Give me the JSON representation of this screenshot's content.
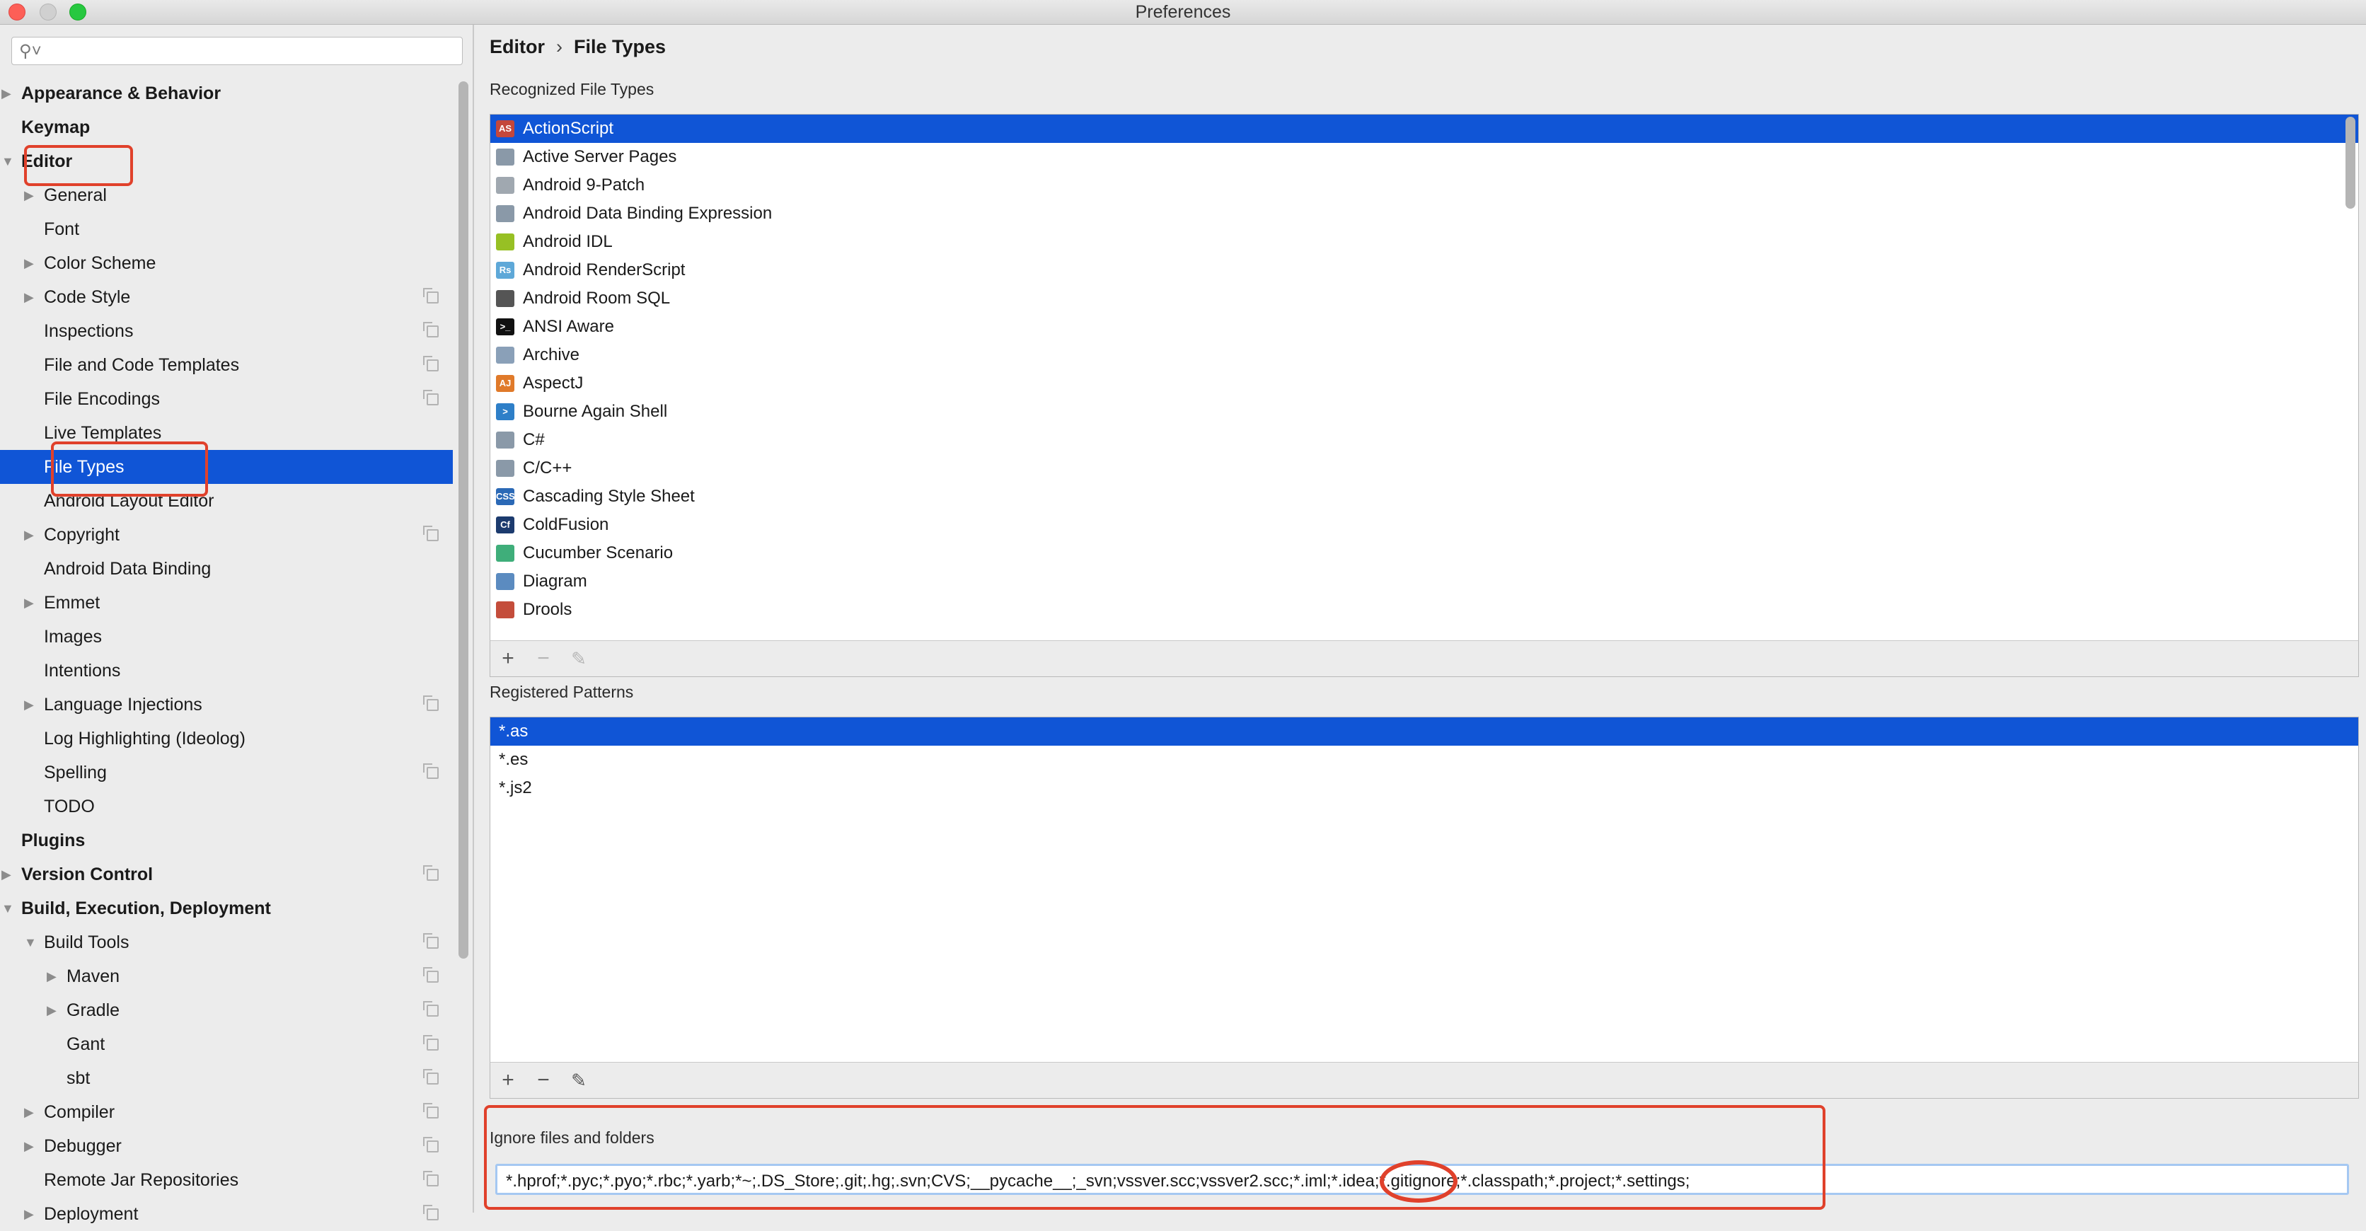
{
  "window": {
    "title": "Preferences"
  },
  "search": {
    "placeholder": "",
    "icon": "search-icon"
  },
  "sidebar": {
    "items": [
      {
        "label": "Appearance & Behavior",
        "level": 0,
        "arrow": "right",
        "bold": true,
        "copy": false
      },
      {
        "label": "Keymap",
        "level": 0,
        "arrow": "",
        "bold": true,
        "copy": false
      },
      {
        "label": "Editor",
        "level": 0,
        "arrow": "down",
        "bold": true,
        "copy": false
      },
      {
        "label": "General",
        "level": 1,
        "arrow": "right",
        "bold": false,
        "copy": false
      },
      {
        "label": "Font",
        "level": 1,
        "arrow": "",
        "bold": false,
        "copy": false
      },
      {
        "label": "Color Scheme",
        "level": 1,
        "arrow": "right",
        "bold": false,
        "copy": false
      },
      {
        "label": "Code Style",
        "level": 1,
        "arrow": "right",
        "bold": false,
        "copy": true
      },
      {
        "label": "Inspections",
        "level": 1,
        "arrow": "",
        "bold": false,
        "copy": true
      },
      {
        "label": "File and Code Templates",
        "level": 1,
        "arrow": "",
        "bold": false,
        "copy": true
      },
      {
        "label": "File Encodings",
        "level": 1,
        "arrow": "",
        "bold": false,
        "copy": true
      },
      {
        "label": "Live Templates",
        "level": 1,
        "arrow": "",
        "bold": false,
        "copy": false
      },
      {
        "label": "File Types",
        "level": 1,
        "arrow": "",
        "bold": false,
        "copy": false,
        "selected": true
      },
      {
        "label": "Android Layout Editor",
        "level": 1,
        "arrow": "",
        "bold": false,
        "copy": false
      },
      {
        "label": "Copyright",
        "level": 1,
        "arrow": "right",
        "bold": false,
        "copy": true
      },
      {
        "label": "Android Data Binding",
        "level": 1,
        "arrow": "",
        "bold": false,
        "copy": false
      },
      {
        "label": "Emmet",
        "level": 1,
        "arrow": "right",
        "bold": false,
        "copy": false
      },
      {
        "label": "Images",
        "level": 1,
        "arrow": "",
        "bold": false,
        "copy": false
      },
      {
        "label": "Intentions",
        "level": 1,
        "arrow": "",
        "bold": false,
        "copy": false
      },
      {
        "label": "Language Injections",
        "level": 1,
        "arrow": "right",
        "bold": false,
        "copy": true
      },
      {
        "label": "Log Highlighting (Ideolog)",
        "level": 1,
        "arrow": "",
        "bold": false,
        "copy": false
      },
      {
        "label": "Spelling",
        "level": 1,
        "arrow": "",
        "bold": false,
        "copy": true
      },
      {
        "label": "TODO",
        "level": 1,
        "arrow": "",
        "bold": false,
        "copy": false
      },
      {
        "label": "Plugins",
        "level": 0,
        "arrow": "",
        "bold": true,
        "copy": false
      },
      {
        "label": "Version Control",
        "level": 0,
        "arrow": "right",
        "bold": true,
        "copy": true
      },
      {
        "label": "Build, Execution, Deployment",
        "level": 0,
        "arrow": "down",
        "bold": true,
        "copy": false
      },
      {
        "label": "Build Tools",
        "level": 1,
        "arrow": "down",
        "bold": false,
        "copy": true
      },
      {
        "label": "Maven",
        "level": 2,
        "arrow": "right",
        "bold": false,
        "copy": true
      },
      {
        "label": "Gradle",
        "level": 2,
        "arrow": "right",
        "bold": false,
        "copy": true
      },
      {
        "label": "Gant",
        "level": 2,
        "arrow": "",
        "bold": false,
        "copy": true
      },
      {
        "label": "sbt",
        "level": 2,
        "arrow": "",
        "bold": false,
        "copy": true
      },
      {
        "label": "Compiler",
        "level": 1,
        "arrow": "right",
        "bold": false,
        "copy": true
      },
      {
        "label": "Debugger",
        "level": 1,
        "arrow": "right",
        "bold": false,
        "copy": true
      },
      {
        "label": "Remote Jar Repositories",
        "level": 1,
        "arrow": "",
        "bold": false,
        "copy": true
      },
      {
        "label": "Deployment",
        "level": 1,
        "arrow": "right",
        "bold": false,
        "copy": true
      }
    ]
  },
  "breadcrumb": {
    "part1": "Editor",
    "separator": "›",
    "part2": "File Types"
  },
  "recognized": {
    "title": "Recognized File Types",
    "items": [
      {
        "label": "ActionScript",
        "icon": "actionscript-icon",
        "icon_color": "#c4473b",
        "icon_text": "AS",
        "selected": true
      },
      {
        "label": "Active Server Pages",
        "icon": "asp-icon",
        "icon_color": "#8a99a8",
        "icon_text": ""
      },
      {
        "label": "Android 9-Patch",
        "icon": "folder-icon",
        "icon_color": "#a0a8b0",
        "icon_text": ""
      },
      {
        "label": "Android Data Binding Expression",
        "icon": "generic-file-icon",
        "icon_color": "#8a99a8",
        "icon_text": ""
      },
      {
        "label": "Android IDL",
        "icon": "android-icon",
        "icon_color": "#97c024",
        "icon_text": ""
      },
      {
        "label": "Android RenderScript",
        "icon": "renderscript-icon",
        "icon_color": "#5ea8d8",
        "icon_text": "Rs"
      },
      {
        "label": "Android Room SQL",
        "icon": "database-icon",
        "icon_color": "#555555",
        "icon_text": ""
      },
      {
        "label": "ANSI Aware",
        "icon": "terminal-icon",
        "icon_color": "#111111",
        "icon_text": ">_"
      },
      {
        "label": "Archive",
        "icon": "archive-icon",
        "icon_color": "#8aa0b8",
        "icon_text": ""
      },
      {
        "label": "AspectJ",
        "icon": "aspectj-icon",
        "icon_color": "#e07a2a",
        "icon_text": "AJ"
      },
      {
        "label": "Bourne Again Shell",
        "icon": "shell-icon",
        "icon_color": "#2e7fc8",
        "icon_text": ">"
      },
      {
        "label": "C#",
        "icon": "csharp-icon",
        "icon_color": "#8a99a8",
        "icon_text": ""
      },
      {
        "label": "C/C++",
        "icon": "cpp-icon",
        "icon_color": "#8a99a8",
        "icon_text": ""
      },
      {
        "label": "Cascading Style Sheet",
        "icon": "css-icon",
        "icon_color": "#2b69b6",
        "icon_text": "CSS"
      },
      {
        "label": "ColdFusion",
        "icon": "coldfusion-icon",
        "icon_color": "#1c3b6e",
        "icon_text": "Cf"
      },
      {
        "label": "Cucumber Scenario",
        "icon": "cucumber-icon",
        "icon_color": "#3fae7a",
        "icon_text": ""
      },
      {
        "label": "Diagram",
        "icon": "diagram-icon",
        "icon_color": "#5b8bc0",
        "icon_text": ""
      },
      {
        "label": "Drools",
        "icon": "drools-icon",
        "icon_color": "#c44d3b",
        "icon_text": ""
      }
    ]
  },
  "patterns": {
    "title": "Registered Patterns",
    "items": [
      {
        "label": "*.as",
        "selected": true
      },
      {
        "label": "*.es",
        "selected": false
      },
      {
        "label": "*.js2",
        "selected": false
      }
    ]
  },
  "toolbar": {
    "add": "+",
    "remove": "−",
    "edit": "✎"
  },
  "ignore": {
    "title": "Ignore files and folders",
    "value": "*.hprof;*.pyc;*.pyo;*.rbc;*.yarb;*~;.DS_Store;.git;.hg;.svn;CVS;__pycache__;_svn;vssver.scc;vssver2.scc;*.iml;*.idea;*.gitignore;*.classpath;*.project;*.settings;"
  },
  "colors": {
    "selection": "#1055d6",
    "annotation": "#e0412b"
  }
}
